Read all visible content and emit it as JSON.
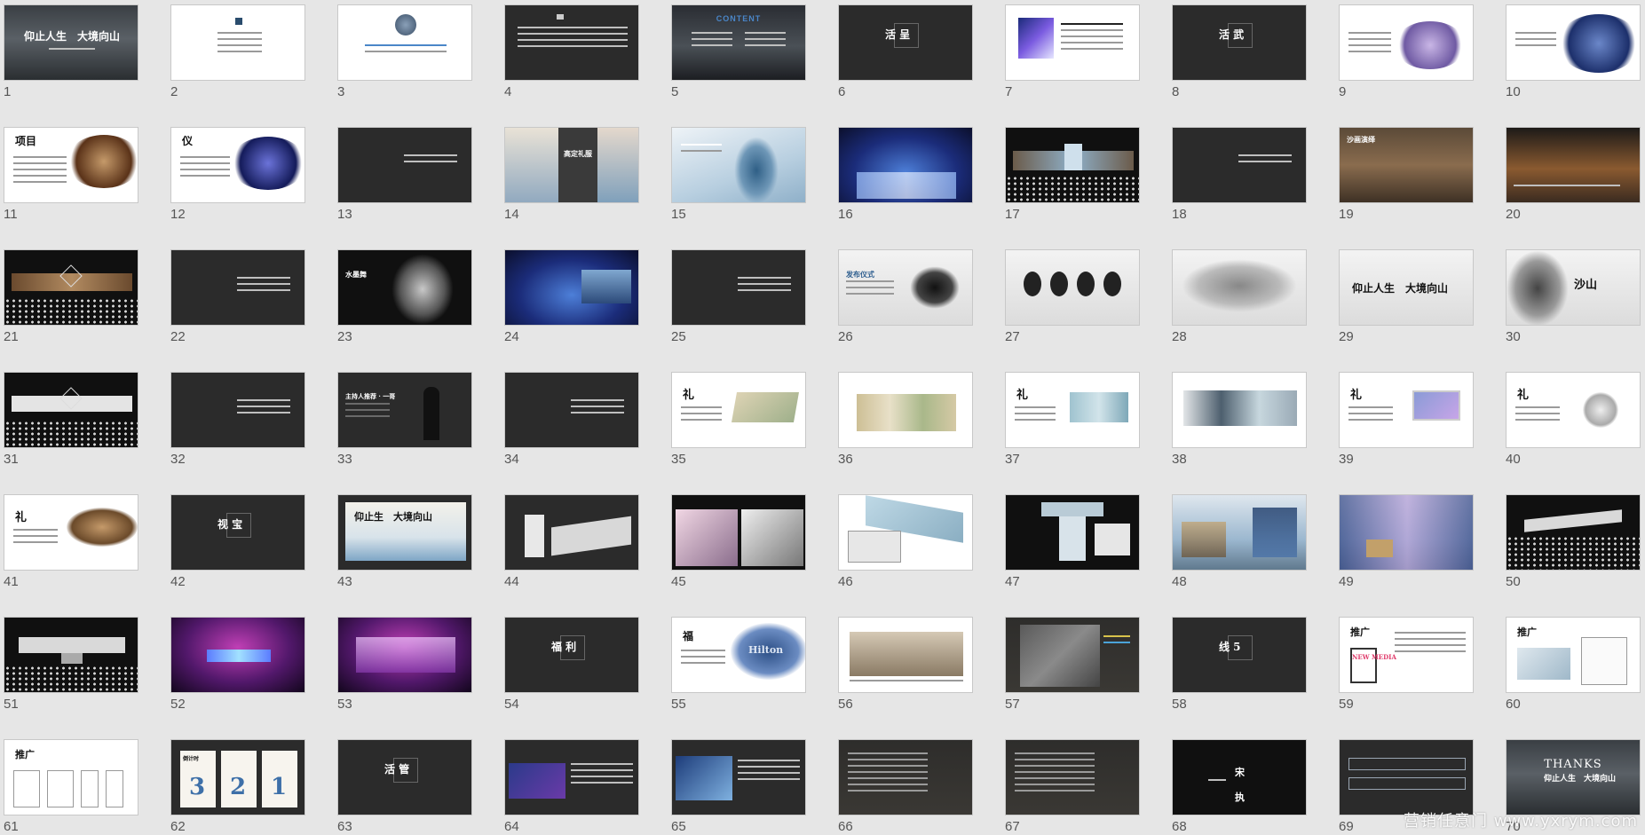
{
  "slides": [
    {
      "n": "1"
    },
    {
      "n": "2"
    },
    {
      "n": "3"
    },
    {
      "n": "4"
    },
    {
      "n": "5"
    },
    {
      "n": "6"
    },
    {
      "n": "7"
    },
    {
      "n": "8"
    },
    {
      "n": "9"
    },
    {
      "n": "10"
    },
    {
      "n": "11"
    },
    {
      "n": "12"
    },
    {
      "n": "13"
    },
    {
      "n": "14"
    },
    {
      "n": "15"
    },
    {
      "n": "16"
    },
    {
      "n": "17"
    },
    {
      "n": "18"
    },
    {
      "n": "19"
    },
    {
      "n": "20"
    },
    {
      "n": "21"
    },
    {
      "n": "22"
    },
    {
      "n": "23"
    },
    {
      "n": "24"
    },
    {
      "n": "25"
    },
    {
      "n": "26"
    },
    {
      "n": "27"
    },
    {
      "n": "28"
    },
    {
      "n": "29"
    },
    {
      "n": "30"
    },
    {
      "n": "31"
    },
    {
      "n": "32"
    },
    {
      "n": "33"
    },
    {
      "n": "34"
    },
    {
      "n": "35"
    },
    {
      "n": "36"
    },
    {
      "n": "37"
    },
    {
      "n": "38"
    },
    {
      "n": "39"
    },
    {
      "n": "40"
    },
    {
      "n": "41"
    },
    {
      "n": "42"
    },
    {
      "n": "43"
    },
    {
      "n": "44"
    },
    {
      "n": "45"
    },
    {
      "n": "46"
    },
    {
      "n": "47"
    },
    {
      "n": "48"
    },
    {
      "n": "49"
    },
    {
      "n": "50"
    },
    {
      "n": "51"
    },
    {
      "n": "52"
    },
    {
      "n": "53"
    },
    {
      "n": "54"
    },
    {
      "n": "55"
    },
    {
      "n": "56"
    },
    {
      "n": "57"
    },
    {
      "n": "58"
    },
    {
      "n": "59"
    },
    {
      "n": "60"
    },
    {
      "n": "61"
    },
    {
      "n": "62"
    },
    {
      "n": "63"
    },
    {
      "n": "64"
    },
    {
      "n": "65"
    },
    {
      "n": "66"
    },
    {
      "n": "67"
    },
    {
      "n": "68"
    },
    {
      "n": "69"
    },
    {
      "n": "70"
    }
  ],
  "thumb_text": {
    "s1_title": "仰止人生　大境向山",
    "s5_title": "CONTENT",
    "s6_title": "活 呈",
    "s8_title": "活 武",
    "s11_title": "项目",
    "s12_title": "仪",
    "s14_title": "高定礼服",
    "s19_title": "沙画演绎",
    "s23_title": "水墨舞",
    "s26_title": "发布仪式",
    "s29_title": "仰止人生　大境向山",
    "s30_title": "沙山",
    "s33_title": "主持人推荐 · 一哥",
    "s35_title": "礼",
    "s37_title": "礼",
    "s39_title": "礼",
    "s40_title": "礼",
    "s41_title": "礼",
    "s42_title": "视 宝",
    "s43_title": "仰止生　大境向山",
    "s54_title": "福 利",
    "s55_title": "福",
    "s55_hilton": "Hilton",
    "s58_title": "线 5",
    "s59_title": "推广",
    "s59_badge": "NEW MEDIA",
    "s60_title": "推广",
    "s61_title": "推广",
    "s62_title": "倒计时",
    "s62_d1": "3",
    "s62_d2": "2",
    "s62_d3": "1",
    "s63_title": "活 管",
    "s68_a": "宋",
    "s68_b": "执",
    "s70_thanks": "THANKS",
    "s70_sub": "仰止人生　大境向山"
  },
  "watermark": "营销任意门  www.yxrym.com",
  "colors": {
    "background": "#e6e6e6",
    "dark_slide": "#2b2b2b",
    "number_text": "#555555"
  }
}
